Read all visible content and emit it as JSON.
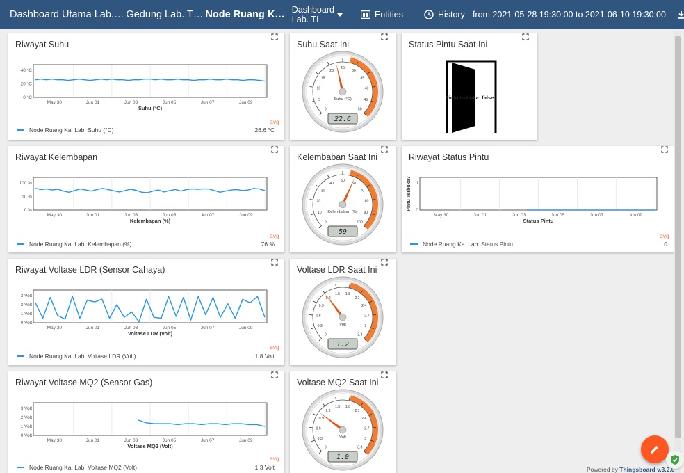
{
  "header": {
    "breadcrumbs": [
      "Dashboard Utama Lab.…",
      "Gedung Lab. T…",
      "Node Ruang K…"
    ],
    "dashboard_select": "Dashboard Lab. TI",
    "entities_label": "Entities",
    "history_label": "History - from 2021-05-28 19:30:00 to 2021-06-10 19:30:00"
  },
  "cards": {
    "suhu_hist": {
      "title": "Riwayat Suhu",
      "legend": "Node Ruang Ka. Lab: Suhu (°C)",
      "avg_label": "avg",
      "avg_value": "26.6 °C"
    },
    "suhu_now": {
      "title": "Suhu Saat Ini"
    },
    "pintu_now": {
      "title": "Status Pintu Saat Ini",
      "door_text": "Pintu terbuka: false"
    },
    "lembab_hist": {
      "title": "Riwayat Kelembapan",
      "legend": "Node Ruang Ka. Lab: Kelembapan (%)",
      "avg_label": "avg",
      "avg_value": "76 %"
    },
    "lembab_now": {
      "title": "Kelembaban Saat Ini"
    },
    "pintu_hist": {
      "title": "Riwayat Status Pintu",
      "legend": "Node Ruang Ka. Lab: Status Pintu",
      "avg_label": "avg",
      "avg_value": "0"
    },
    "ldr_hist": {
      "title": "Riwayat Voltase LDR (Sensor Cahaya)",
      "legend": "Node Ruang Ka. Lab: Voltase LDR (Volt)",
      "avg_label": "avg",
      "avg_value": "1.8 Volt"
    },
    "ldr_now": {
      "title": "Voltase LDR Saat Ini"
    },
    "mq2_hist": {
      "title": "Riwayat Voltase MQ2 (Sensor Gas)",
      "legend": "Node Ruang Ka. Lab: Voltase MQ2 (Volt)",
      "avg_label": "avg",
      "avg_value": "1.3 Volt"
    },
    "mq2_now": {
      "title": "Voltase MQ2 Saat Ini"
    }
  },
  "footer": {
    "powered_by": "Powered by",
    "brand": "Thingsboard v.3.2.0"
  },
  "colors": {
    "header": "#305680",
    "series": "#2196f3",
    "accent": "#ff5722"
  },
  "chart_data": [
    {
      "type": "line",
      "id": "suhu_hist",
      "xlabel": "Suhu (°C)",
      "x_ticks": [
        "May 30",
        "Jun 01",
        "Jun 03",
        "Jun 05",
        "Jun 07",
        "Jun 09"
      ],
      "y_ticks": [
        "40 °C",
        "20 °C",
        "0 °C"
      ],
      "ylim": [
        0,
        40
      ],
      "series": [
        {
          "name": "Node Ruang Ka. Lab: Suhu (°C)",
          "values": [
            26,
            27,
            26,
            27,
            26,
            26,
            25,
            26,
            27,
            26,
            25,
            26,
            27,
            26,
            27,
            26,
            26,
            25,
            26,
            26,
            27,
            27,
            26,
            27,
            26,
            26,
            27,
            26,
            26,
            25,
            26,
            26,
            27,
            26,
            26,
            27,
            26,
            26,
            25,
            26,
            26,
            25,
            24
          ]
        }
      ]
    },
    {
      "type": "line",
      "id": "lembab_hist",
      "xlabel": "Kelembapan (%)",
      "x_ticks": [
        "May 30",
        "Jun 01",
        "Jun 03",
        "Jun 05",
        "Jun 07",
        "Jun 09"
      ],
      "y_ticks": [
        "100 %",
        "50 %",
        "0 %"
      ],
      "ylim": [
        0,
        100
      ],
      "series": [
        {
          "name": "Node Ruang Ka. Lab: Kelembapan (%)",
          "values": [
            80,
            76,
            78,
            74,
            77,
            70,
            66,
            72,
            78,
            74,
            70,
            76,
            80,
            76,
            71,
            67,
            72,
            77,
            73,
            66,
            64,
            70,
            74,
            67,
            72,
            76,
            70,
            76,
            78,
            77,
            78,
            78,
            72,
            66,
            70,
            74,
            76,
            72,
            74,
            80,
            78,
            72
          ]
        }
      ]
    },
    {
      "type": "line",
      "id": "pintu_hist",
      "xlabel": "Status Pintu",
      "ylabel": "Pintu Terbuka?",
      "x_ticks": [
        "May 30",
        "Jun 01",
        "Jun 03",
        "Jun 05",
        "Jun 07",
        "Jun 09"
      ],
      "y_ticks": [
        "1",
        "0"
      ],
      "ylim": [
        0,
        1
      ],
      "series": [
        {
          "name": "Node Ruang Ka. Lab: Status Pintu",
          "values": [
            null,
            null,
            null,
            null,
            null,
            null,
            null,
            null,
            null,
            null,
            null,
            null,
            null,
            0,
            0,
            0,
            0,
            0,
            0,
            0,
            0,
            0,
            0,
            0,
            0,
            0,
            0,
            0,
            0,
            0
          ]
        }
      ]
    },
    {
      "type": "line",
      "id": "ldr_hist",
      "xlabel": "Voltase LDR (Volt)",
      "x_ticks": [
        "May 30",
        "Jun 01",
        "Jun 03",
        "Jun 05",
        "Jun 07",
        "Jun 09"
      ],
      "y_ticks": [
        "3 Volt",
        "2 Volt",
        "1 Volt",
        "0 Volt"
      ],
      "ylim": [
        0,
        3
      ],
      "series": [
        {
          "name": "Node Ruang Ka. Lab: Voltase LDR (Volt)",
          "values": [
            2.2,
            0.5,
            2.8,
            0.8,
            0.4,
            2.9,
            0.5,
            2.5,
            2.3,
            2.6,
            0.5,
            2.0,
            0.6,
            1.2,
            0.1,
            2.6,
            0.6,
            0.5,
            2.9,
            0.7,
            2.8,
            0.3,
            2.9,
            0.9,
            2.8,
            0.6,
            2.1,
            0.5,
            2.6,
            2.2,
            2.9,
            0.6
          ]
        }
      ]
    },
    {
      "type": "line",
      "id": "mq2_hist",
      "xlabel": "Voltase MQ2 (Volt)",
      "x_ticks": [
        "May 30",
        "Jun 01",
        "Jun 03",
        "Jun 05",
        "Jun 07",
        "Jun 09"
      ],
      "y_ticks": [
        "3 Volt",
        "2 Volt",
        "1 Volt",
        "0 Volt"
      ],
      "ylim": [
        0,
        3
      ],
      "series": [
        {
          "name": "Node Ruang Ka. Lab: Voltase MQ2 (Volt)",
          "values": [
            null,
            null,
            null,
            null,
            null,
            null,
            null,
            null,
            null,
            null,
            null,
            null,
            null,
            1.7,
            1.4,
            1.3,
            1.3,
            1.3,
            1.2,
            1.3,
            1.3,
            1.2,
            1.3,
            1.3,
            1.2,
            1.3,
            1.3,
            1.2,
            1.2,
            1.0
          ]
        }
      ]
    }
  ],
  "gauges": [
    {
      "id": "suhu_now",
      "ticks": [
        "0",
        "5",
        "10",
        "15",
        "20",
        "25",
        "30",
        "35",
        "40",
        "45",
        "50"
      ],
      "min": 0,
      "max": 50,
      "value": 22.6,
      "unit_label": "Suhu (°C)",
      "lcd": "22.6"
    },
    {
      "id": "lembab_now",
      "ticks": [
        "0",
        "10",
        "20",
        "30",
        "40",
        "50",
        "60",
        "70",
        "80",
        "90",
        "100"
      ],
      "min": 0,
      "max": 100,
      "value": 59,
      "unit_label": "Kelembaban (%)",
      "lcd": "59"
    },
    {
      "id": "ldr_now",
      "ticks": [
        "0",
        "0.3",
        "0.6",
        "0.9",
        "1.2",
        "1.5",
        "1.8",
        "2.1",
        "2.4",
        "2.7",
        "3",
        "3.3"
      ],
      "min": 0,
      "max": 3.3,
      "value": 1.2,
      "unit_label": "Volt",
      "lcd": "1.2"
    },
    {
      "id": "mq2_now",
      "ticks": [
        "0",
        "0.3",
        "0.6",
        "0.9",
        "1.2",
        "1.5",
        "1.8",
        "2.1",
        "2.4",
        "2.7",
        "3",
        "3.3"
      ],
      "min": 0,
      "max": 3.3,
      "value": 1.0,
      "unit_label": "Volt",
      "lcd": "1.0"
    }
  ]
}
